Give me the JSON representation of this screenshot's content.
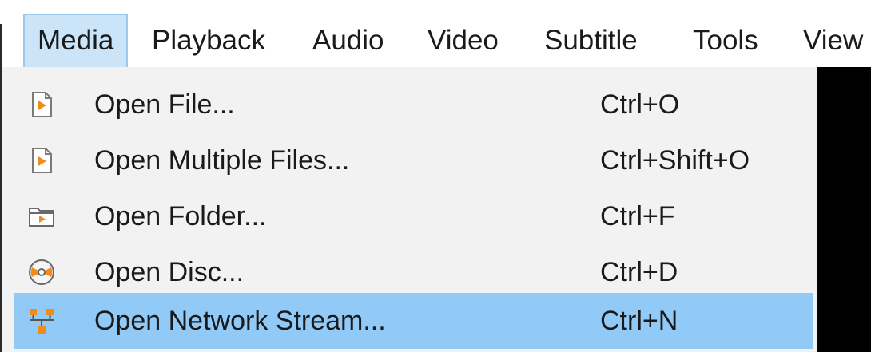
{
  "menubar": {
    "items": [
      {
        "label": "Media",
        "active": true
      },
      {
        "label": "Playback"
      },
      {
        "label": "Audio"
      },
      {
        "label": "Video"
      },
      {
        "label": "Subtitle"
      },
      {
        "label": "Tools"
      },
      {
        "label": "View"
      }
    ]
  },
  "media_menu": {
    "items": [
      {
        "label": "Open File...",
        "shortcut": "Ctrl+O",
        "icon": "file-play-icon"
      },
      {
        "label": "Open Multiple Files...",
        "shortcut": "Ctrl+Shift+O",
        "icon": "file-play-icon"
      },
      {
        "label": "Open Folder...",
        "shortcut": "Ctrl+F",
        "icon": "folder-play-icon"
      },
      {
        "label": "Open Disc...",
        "shortcut": "Ctrl+D",
        "icon": "disc-icon"
      },
      {
        "label": "Open Network Stream...",
        "shortcut": "Ctrl+N",
        "icon": "network-icon",
        "highlighted": true
      }
    ]
  },
  "colors": {
    "menu_background": "#f2f2f2",
    "highlight": "#91c9f7",
    "active_menubar_item": "#cce4f7",
    "icon_orange": "#f08c1e"
  }
}
